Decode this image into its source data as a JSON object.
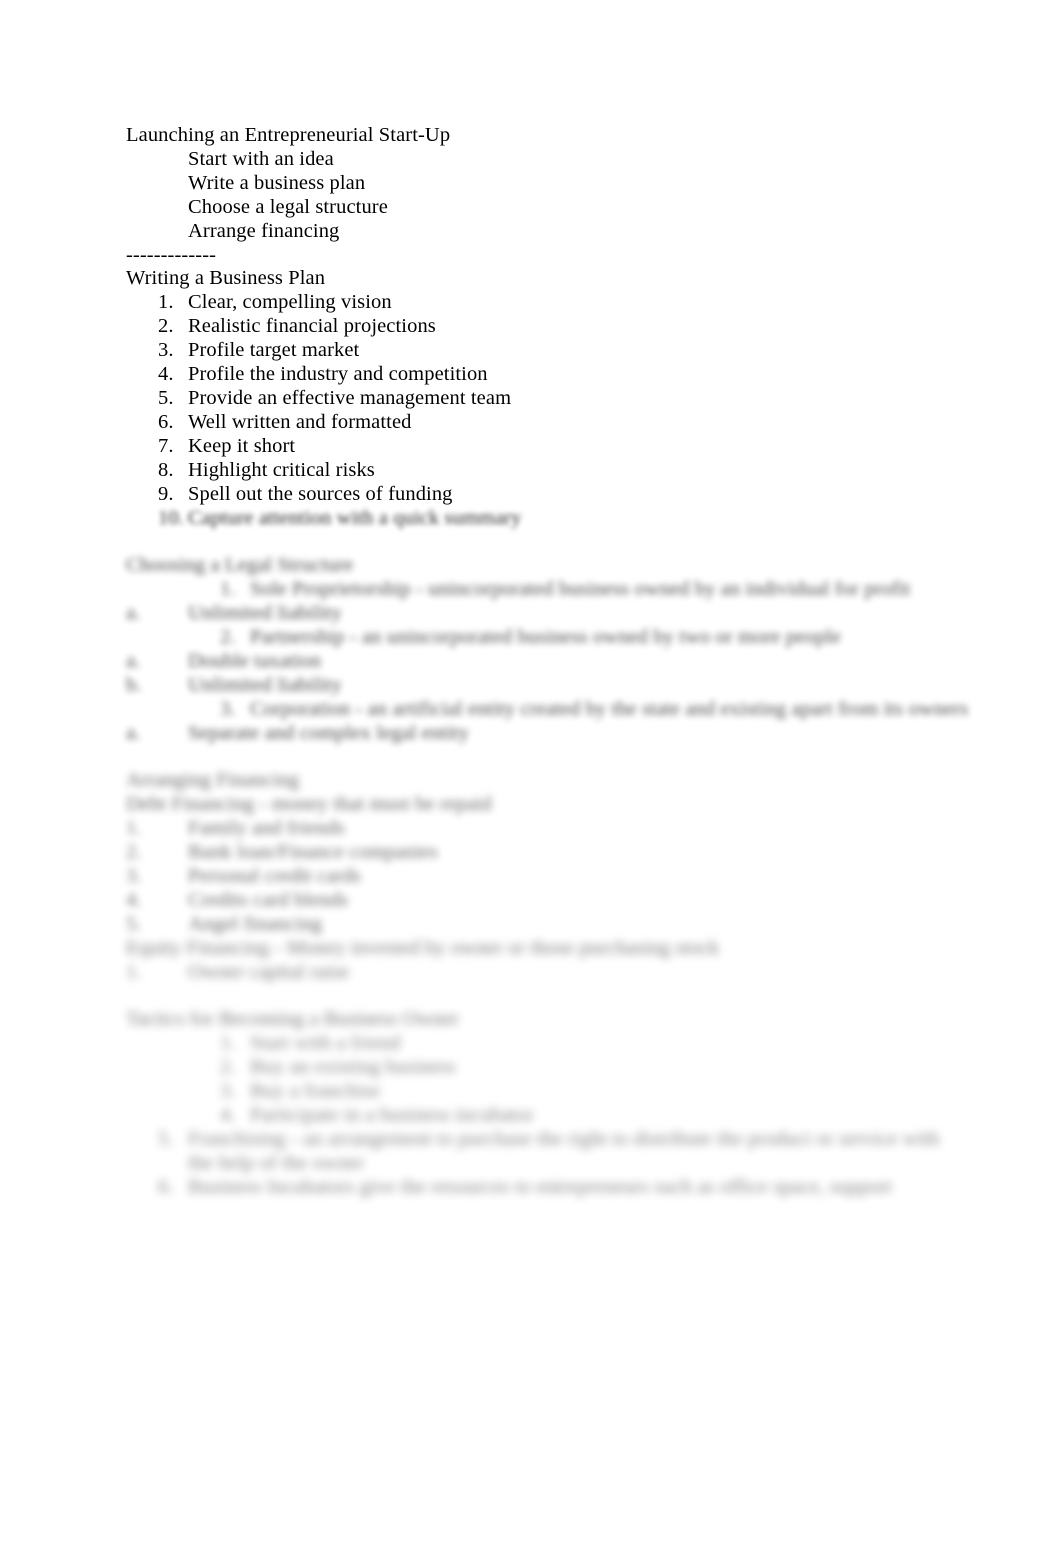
{
  "document": {
    "title_line": "Launching an Entrepreneurial Start-Up",
    "separator": "-------------",
    "section_business_plan_heading": "Writing a Business Plan",
    "section_legal_heading": "Choosing a Legal Structure",
    "section_financing_heading": "Arranging Financing",
    "section_tactics_heading": "Tactics for Becoming a Business Owner"
  },
  "startup_steps": [
    "Start with an idea",
    "Write a business plan",
    "Choose a legal structure",
    "Arrange financing"
  ],
  "business_plan_items": [
    {
      "num": "1.",
      "text": "Clear, compelling vision"
    },
    {
      "num": "2.",
      "text": "Realistic financial projections"
    },
    {
      "num": "3.",
      "text": "Profile target market"
    },
    {
      "num": "4.",
      "text": "Profile the industry and competition"
    },
    {
      "num": "5.",
      "text": "Provide an effective management team"
    },
    {
      "num": "6.",
      "text": "Well written and formatted"
    },
    {
      "num": "7.",
      "text": "Keep it short"
    },
    {
      "num": "8.",
      "text": "Highlight critical risks"
    },
    {
      "num": "9.",
      "text": "Spell out the sources of funding"
    },
    {
      "num": "10.",
      "text": "Capture attention with a quick summary"
    }
  ],
  "legal_structure_items": [
    {
      "num": "1.",
      "text": "Sole Proprietorship - unincorporated business owned by an individual for profit"
    },
    {
      "num": "a.",
      "text": "Unlimited liability"
    },
    {
      "num": "2.",
      "text": "Partnership - an unincorporated business owned by two or more people"
    },
    {
      "num": "a.",
      "text": "Double taxation"
    },
    {
      "num": "b.",
      "text": "Unlimited liability"
    },
    {
      "num": "3.",
      "text": "Corporation - an artificial entity created by the state and existing apart from its owners"
    },
    {
      "num": "a.",
      "text": "Separate and complex legal entity"
    }
  ],
  "financing": {
    "debt_line": "Debt Financing - money that must be repaid",
    "debt_items": [
      {
        "num": "1.",
        "text": "Family and friends"
      },
      {
        "num": "2.",
        "text": "Bank loan/Finance companies"
      },
      {
        "num": "3.",
        "text": "Personal credit cards"
      },
      {
        "num": "4.",
        "text": "Credits card blends"
      },
      {
        "num": "5.",
        "text": "Angel financing"
      }
    ],
    "equity_line": "Equity Financing - Money invested by owner or those purchasing stock",
    "equity_items": [
      {
        "num": "1.",
        "text": "Owner capital raise"
      }
    ]
  },
  "tactics_items": [
    {
      "num": "1.",
      "text": "Start with a friend"
    },
    {
      "num": "2.",
      "text": "Buy an existing business"
    },
    {
      "num": "3.",
      "text": "Buy a franchise"
    },
    {
      "num": "4.",
      "text": "Participate in a business incubator"
    },
    {
      "num": "5.",
      "text": "Franchising - an arrangement to purchase the right to distribute the product or service with the help of the owner"
    },
    {
      "num": "6.",
      "text": "Business Incubators give the resources to entrepreneurs such as office space, support"
    }
  ],
  "colors": {
    "text": "#1a1a1a",
    "page_background": "#ffffff"
  }
}
